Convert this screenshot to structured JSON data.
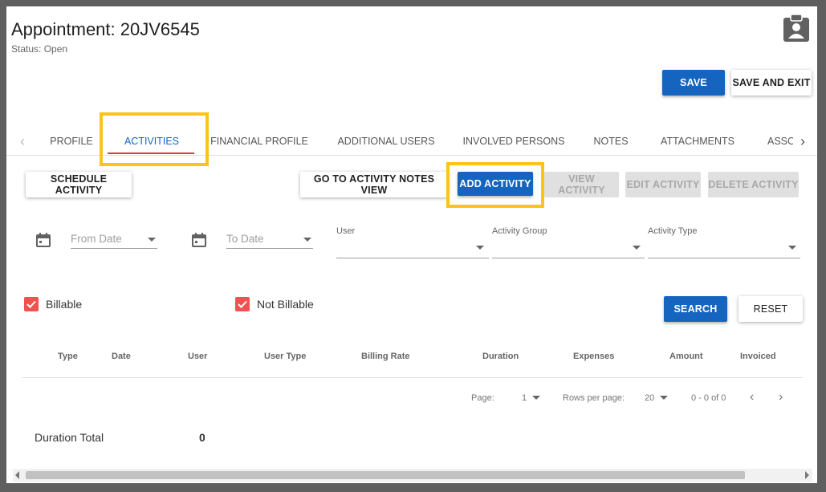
{
  "header": {
    "title": "Appointment: 20JV6545",
    "status": "Status: Open"
  },
  "actions": {
    "save": "SAVE",
    "save_and_exit": "SAVE AND EXIT"
  },
  "tabs": [
    {
      "label": "PROFILE",
      "active": false
    },
    {
      "label": "ACTIVITIES",
      "active": true
    },
    {
      "label": "FINANCIAL PROFILE",
      "active": false
    },
    {
      "label": "ADDITIONAL USERS",
      "active": false
    },
    {
      "label": "INVOLVED PERSONS",
      "active": false
    },
    {
      "label": "NOTES",
      "active": false
    },
    {
      "label": "ATTACHMENTS",
      "active": false
    },
    {
      "label": "ASSO",
      "active": false
    }
  ],
  "toolbar": {
    "schedule_activity": "SCHEDULE ACTIVITY",
    "go_to_notes": "GO TO ACTIVITY NOTES VIEW",
    "add_activity": "ADD ACTIVITY",
    "view_activity": "VIEW ACTIVITY",
    "edit_activity": "EDIT ACTIVITY",
    "delete_activity": "DELETE ACTIVITY"
  },
  "filters": {
    "from_date_placeholder": "From Date",
    "to_date_placeholder": "To Date",
    "user_label": "User",
    "activity_group_label": "Activity Group",
    "activity_type_label": "Activity Type",
    "billable_label": "Billable",
    "billable_checked": true,
    "not_billable_label": "Not Billable",
    "not_billable_checked": true,
    "search": "SEARCH",
    "reset": "RESET"
  },
  "table": {
    "columns": [
      "Type",
      "Date",
      "User",
      "User Type",
      "Billing Rate",
      "Duration",
      "Expenses",
      "Amount",
      "Invoiced"
    ],
    "rows": []
  },
  "pagination": {
    "page_label": "Page:",
    "page_value": "1",
    "rows_label": "Rows per page:",
    "rows_value": "20",
    "range": "0 - 0 of 0"
  },
  "totals": {
    "duration_label": "Duration Total",
    "duration_value": "0"
  },
  "colors": {
    "primary": "#1565c0",
    "highlight": "#fcc419",
    "active_underline": "#e53935",
    "checkbox": "#ef5350"
  }
}
